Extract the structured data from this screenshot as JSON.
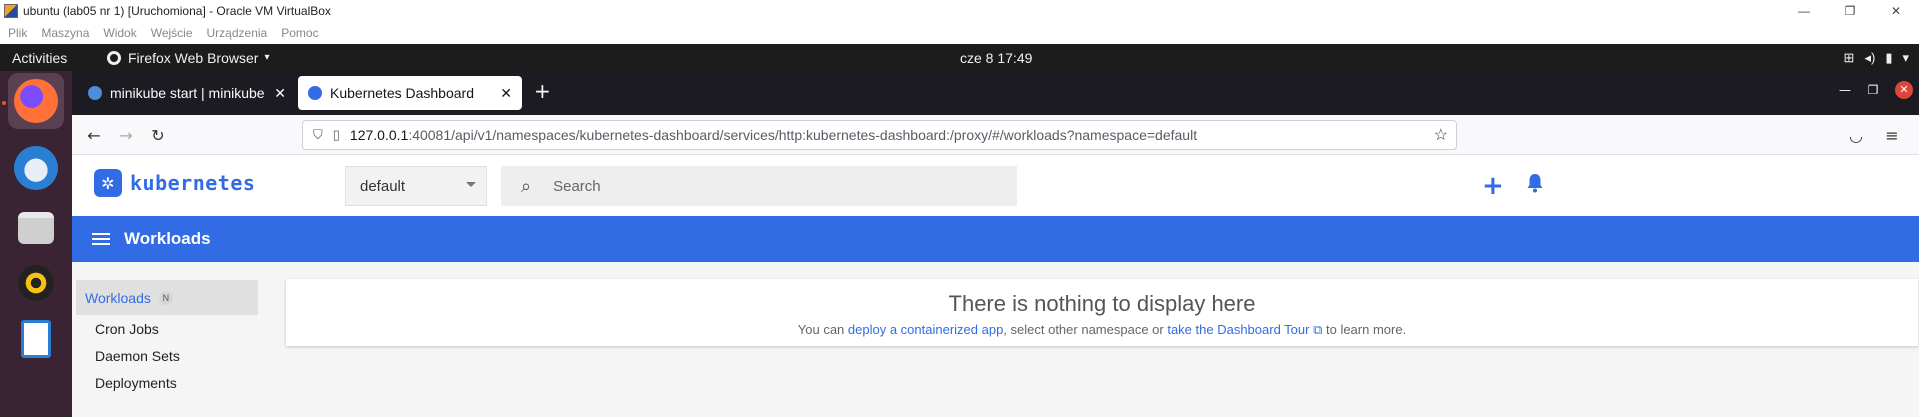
{
  "vbox": {
    "title": "ubuntu (lab05 nr 1) [Uruchomiona] - Oracle VM VirtualBox",
    "menu": [
      "Plik",
      "Maszyna",
      "Widok",
      "Wejście",
      "Urządzenia",
      "Pomoc"
    ],
    "minimize": "—",
    "restore": "❐",
    "close": "✕"
  },
  "gnome": {
    "activities": "Activities",
    "app_name": "Firefox Web Browser",
    "app_caret": "▾",
    "clock": "cze 8  17:49",
    "tray_network": "⊞",
    "tray_volume": "◂)",
    "tray_battery": "▮",
    "tray_menu": "▾"
  },
  "dock": {
    "items": [
      "firefox",
      "thunderbird",
      "files",
      "rhythmbox",
      "libreoffice-writer"
    ]
  },
  "firefox": {
    "tabs": [
      {
        "label": "minikube start | minikube",
        "close": "✕"
      },
      {
        "label": "Kubernetes Dashboard",
        "close": "✕"
      }
    ],
    "new_tab": "+",
    "win_min": "—",
    "win_max": "❐",
    "win_close": "✕",
    "back": "←",
    "forward": "→",
    "reload": "↻",
    "url_host": "127.0.0.1",
    "url_rest": ":40081/api/v1/namespaces/kubernetes-dashboard/services/http:kubernetes-dashboard:/proxy/#/workloads?namespace=default",
    "star": "☆",
    "pocket": "◡",
    "menu": "≡"
  },
  "dashboard": {
    "logo_text": "kubernetes",
    "namespace": "default",
    "search_placeholder": "Search",
    "add": "+",
    "toolbar_title": "Workloads",
    "sidebar": {
      "workloads": "Workloads",
      "workloads_badge": "N",
      "items": [
        "Cron Jobs",
        "Daemon Sets",
        "Deployments"
      ]
    },
    "empty": {
      "heading": "There is nothing to display here",
      "prefix": "You can ",
      "link1": "deploy a containerized app",
      "middle": ", select other namespace or ",
      "link2": "take the Dashboard Tour",
      "ext": " ⧉",
      "suffix": " to learn more."
    },
    "colors": {
      "accent": "#326ce5"
    }
  }
}
